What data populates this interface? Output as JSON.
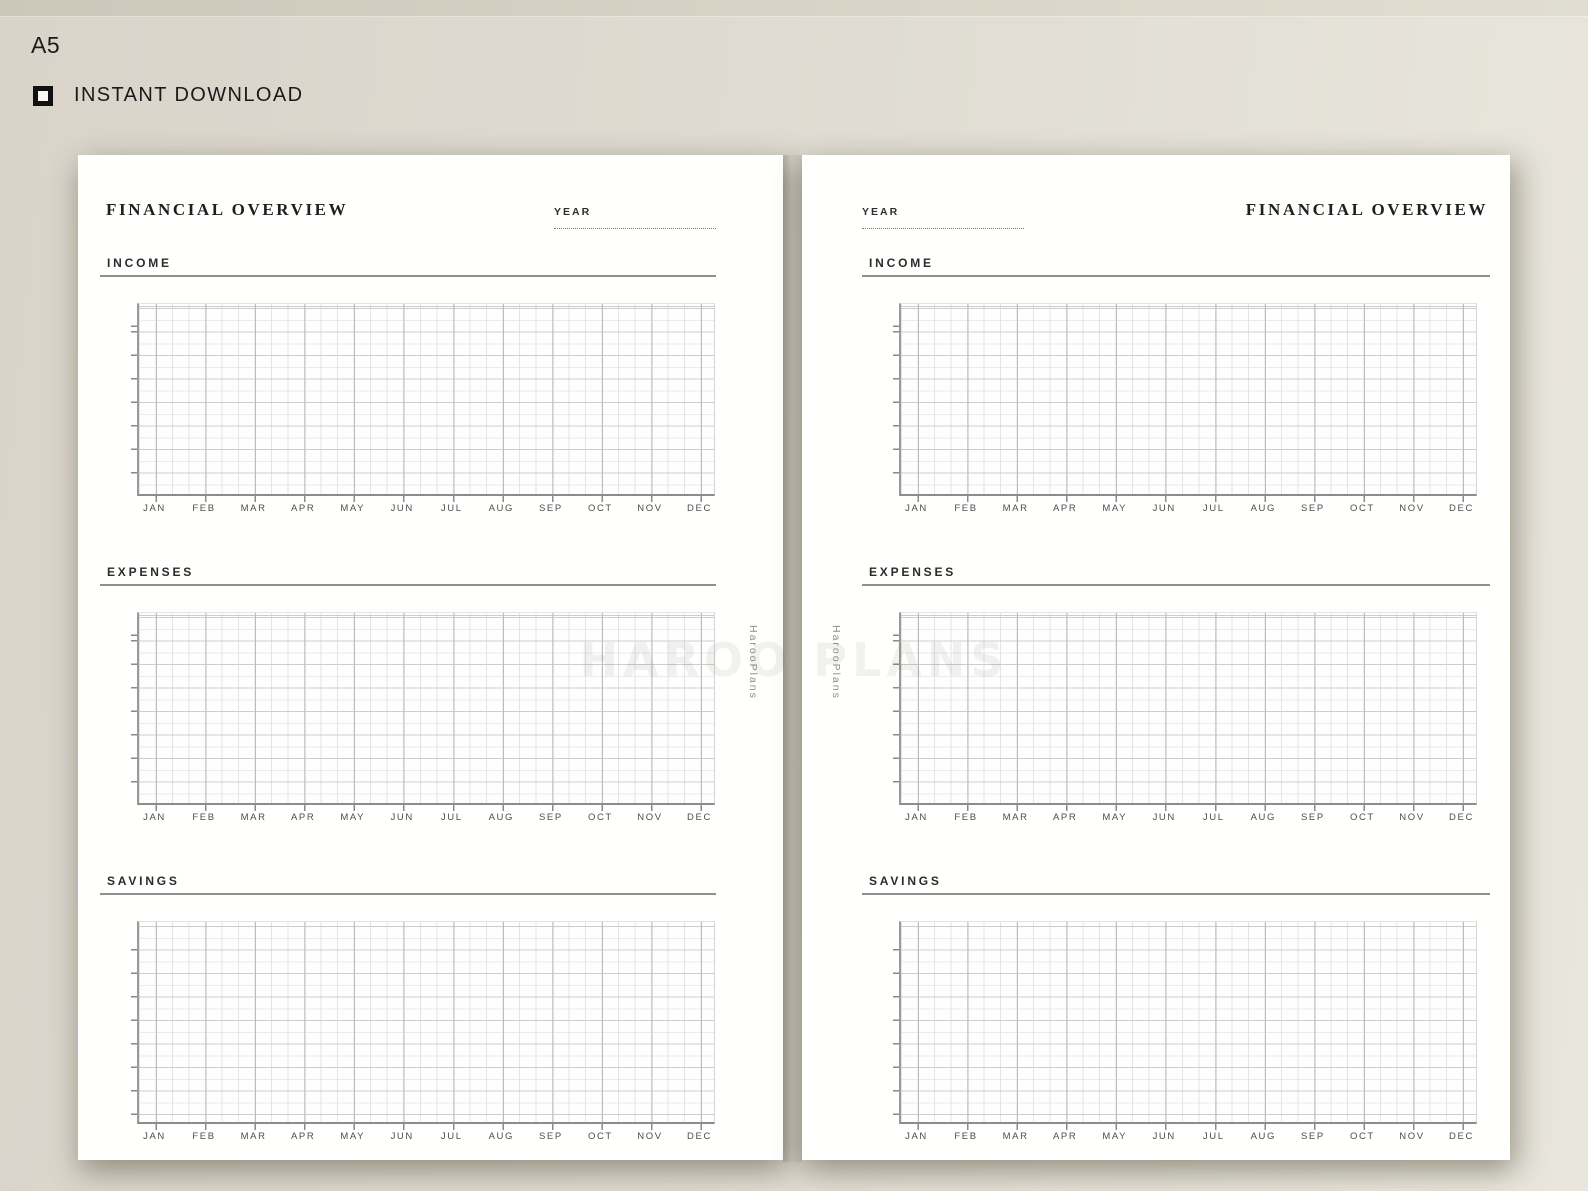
{
  "size_label": "A5",
  "badge": {
    "label": "INSTANT DOWNLOAD"
  },
  "watermark": {
    "big": "HAROO PLANS",
    "side": "HarooPlans"
  },
  "page": {
    "title": "FINANCIAL OVERVIEW",
    "year_label": "YEAR",
    "sections": [
      "INCOME",
      "EXPENSES",
      "SAVINGS"
    ]
  },
  "months": [
    "JAN",
    "FEB",
    "MAR",
    "APR",
    "MAY",
    "JUN",
    "JUL",
    "AUG",
    "SEP",
    "OCT",
    "NOV",
    "DEC"
  ],
  "colors": {
    "background_left": "#d9d4ca",
    "background_right": "#e9e6dd",
    "page": "#fffffe",
    "axis": "#8c8c8c",
    "grid_major": "#bcbcbc",
    "grid_minor": "#e4e4e4",
    "text": "#1f1f1f"
  }
}
